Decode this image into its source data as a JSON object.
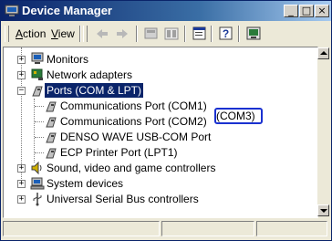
{
  "window": {
    "title": "Device Manager"
  },
  "titlebar": {
    "minimize": "_",
    "maximize": "□",
    "close": "×"
  },
  "menu": {
    "items": [
      {
        "label_u": "A",
        "label_rest": "ction"
      },
      {
        "label_u": "V",
        "label_rest": "iew"
      }
    ]
  },
  "toolbar": {
    "icons": [
      "back-icon",
      "forward-icon",
      "up-icon",
      "properties-view-icon",
      "properties-icon",
      "help-icon",
      "scan-hardware-icon"
    ]
  },
  "tree": {
    "monitors": "Monitors",
    "network": "Network adapters",
    "ports": "Ports (COM & LPT)",
    "com1": "Communications Port (COM1)",
    "com2": "Communications Port (COM2)",
    "denso": "DENSO WAVE USB-COM Port",
    "denso_port": "(COM3)",
    "ecp": "ECP Printer Port (LPT1)",
    "sound": "Sound, video and game controllers",
    "system": "System devices",
    "usb": "Universal Serial Bus controllers"
  },
  "expanders": {
    "collapsed": "+",
    "expanded": "−"
  },
  "colors": {
    "selection": "#0a246a",
    "highlight_box": "#1a31d0",
    "titlebar": "#0a246a"
  }
}
